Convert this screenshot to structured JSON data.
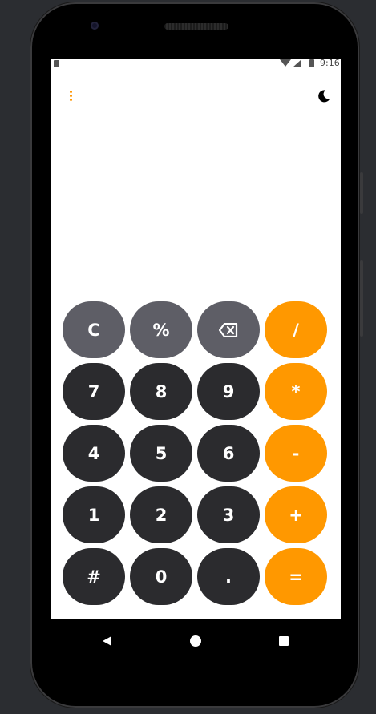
{
  "status_bar": {
    "time": "9:16",
    "icons": [
      "sim-icon",
      "wifi-icon",
      "signal-icon",
      "battery-icon"
    ]
  },
  "toolbar": {
    "menu_icon": "more-vert-icon",
    "theme_icon": "moon-icon"
  },
  "display": {
    "expression": "",
    "result": ""
  },
  "colors": {
    "accent": "#ff9800",
    "function_key": "#5e5e66",
    "digit_key": "#2b2b2e",
    "screen_bg": "#ffffff"
  },
  "keys": [
    {
      "label": "C",
      "name": "clear-button",
      "style": "gray"
    },
    {
      "label": "%",
      "name": "percent-button",
      "style": "gray"
    },
    {
      "label": "",
      "name": "backspace-button",
      "style": "gray",
      "icon": "backspace-icon"
    },
    {
      "label": "/",
      "name": "divide-button",
      "style": "orange"
    },
    {
      "label": "7",
      "name": "digit-7-button",
      "style": "dark"
    },
    {
      "label": "8",
      "name": "digit-8-button",
      "style": "dark"
    },
    {
      "label": "9",
      "name": "digit-9-button",
      "style": "dark"
    },
    {
      "label": "*",
      "name": "multiply-button",
      "style": "orange"
    },
    {
      "label": "4",
      "name": "digit-4-button",
      "style": "dark"
    },
    {
      "label": "5",
      "name": "digit-5-button",
      "style": "dark"
    },
    {
      "label": "6",
      "name": "digit-6-button",
      "style": "dark"
    },
    {
      "label": "-",
      "name": "subtract-button",
      "style": "orange"
    },
    {
      "label": "1",
      "name": "digit-1-button",
      "style": "dark"
    },
    {
      "label": "2",
      "name": "digit-2-button",
      "style": "dark"
    },
    {
      "label": "3",
      "name": "digit-3-button",
      "style": "dark"
    },
    {
      "label": "+",
      "name": "add-button",
      "style": "orange"
    },
    {
      "label": "#",
      "name": "hash-button",
      "style": "dark"
    },
    {
      "label": "0",
      "name": "digit-0-button",
      "style": "dark"
    },
    {
      "label": ".",
      "name": "decimal-button",
      "style": "dark"
    },
    {
      "label": "=",
      "name": "equals-button",
      "style": "orange"
    }
  ],
  "nav_bar": {
    "back_icon": "back-triangle-icon",
    "home_icon": "home-circle-icon",
    "recents_icon": "recents-square-icon"
  }
}
